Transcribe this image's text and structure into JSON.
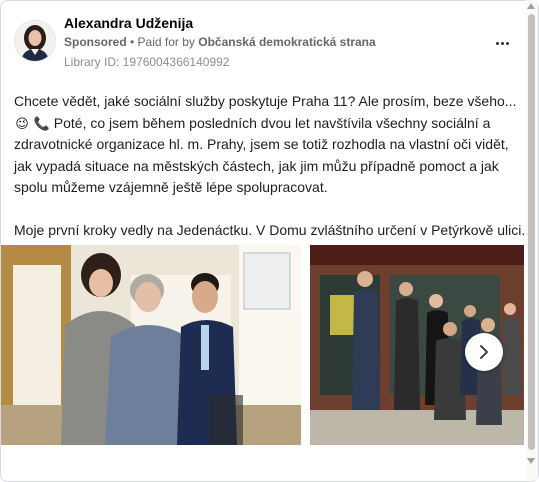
{
  "post": {
    "author_name": "Alexandra Udženija",
    "sponsored_label": "Sponsored",
    "separator": " • ",
    "paid_for_prefix": "Paid for by ",
    "paid_for_org": "Občanská demokratická strana",
    "library_id": "Library ID: 1976004366140992",
    "more_icon": "more-horizontal-icon"
  },
  "body": {
    "line1": "Chcete vědět, jaké sociální služby poskytuje Praha 11? Ale prosím, beze všeho...",
    "emoji_wink": "😉",
    "emoji_phone": "📞",
    "line2": "Poté, co jsem během posledních dvou let navštívila všechny sociální a zdravotnické organizace hl. m. Prahy, jsem se totiž rozhodla na vlastní oči vidět, jak vypadá situace na městských částech, jak jim můžu případně pomoct a jak spolu můžeme vzájemně ještě lépe spolupracovat.",
    "line3": "Moje první kroky vedly na Jedenáctku. V Domu zvláštního určení v Petýrkově ulici..."
  },
  "carousel": {
    "next_icon": "chevron-right-icon",
    "cards": [
      {
        "name": "photo-visit-elderly-lady"
      },
      {
        "name": "photo-group-in-front-of-building"
      }
    ]
  },
  "colors": {
    "text": "#1c1e21",
    "muted": "#65676b",
    "border": "#d6d9de"
  }
}
